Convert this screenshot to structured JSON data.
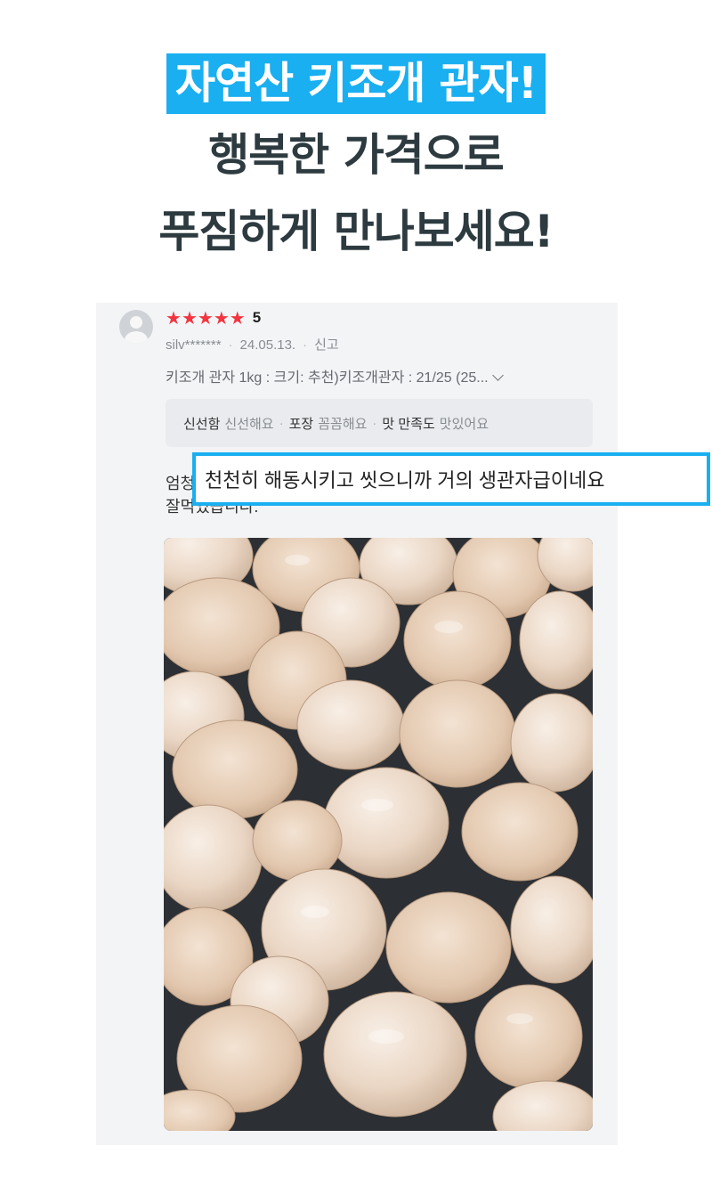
{
  "headline": {
    "line1": "자연산 키조개 관자!",
    "line2": "행복한 가격으로",
    "line3": "푸짐하게 만나보세요!"
  },
  "review": {
    "stars_count": 5,
    "rating": "5",
    "user": "silv*******",
    "date": "24.05.13.",
    "report": "신고",
    "option": "키조개 관자 1kg : 크기: 추천)키조개관자 : 21/25 (25...",
    "attributes": [
      {
        "key": "신선함",
        "value": "신선해요"
      },
      {
        "key": "포장",
        "value": "꼼꼼해요"
      },
      {
        "key": "맛 만족도",
        "value": "맛있어요"
      }
    ],
    "text_line1": "엄청",
    "text_line2": "잘먹었습니다.",
    "highlight": "천천히 해동시키고 씻으니까 거의 생관자급이네요",
    "photo_desc_icon": "scallop-photo"
  },
  "colors": {
    "accent": "#19aff0",
    "headline_text": "#2d3b40",
    "star": "#f4343e"
  }
}
